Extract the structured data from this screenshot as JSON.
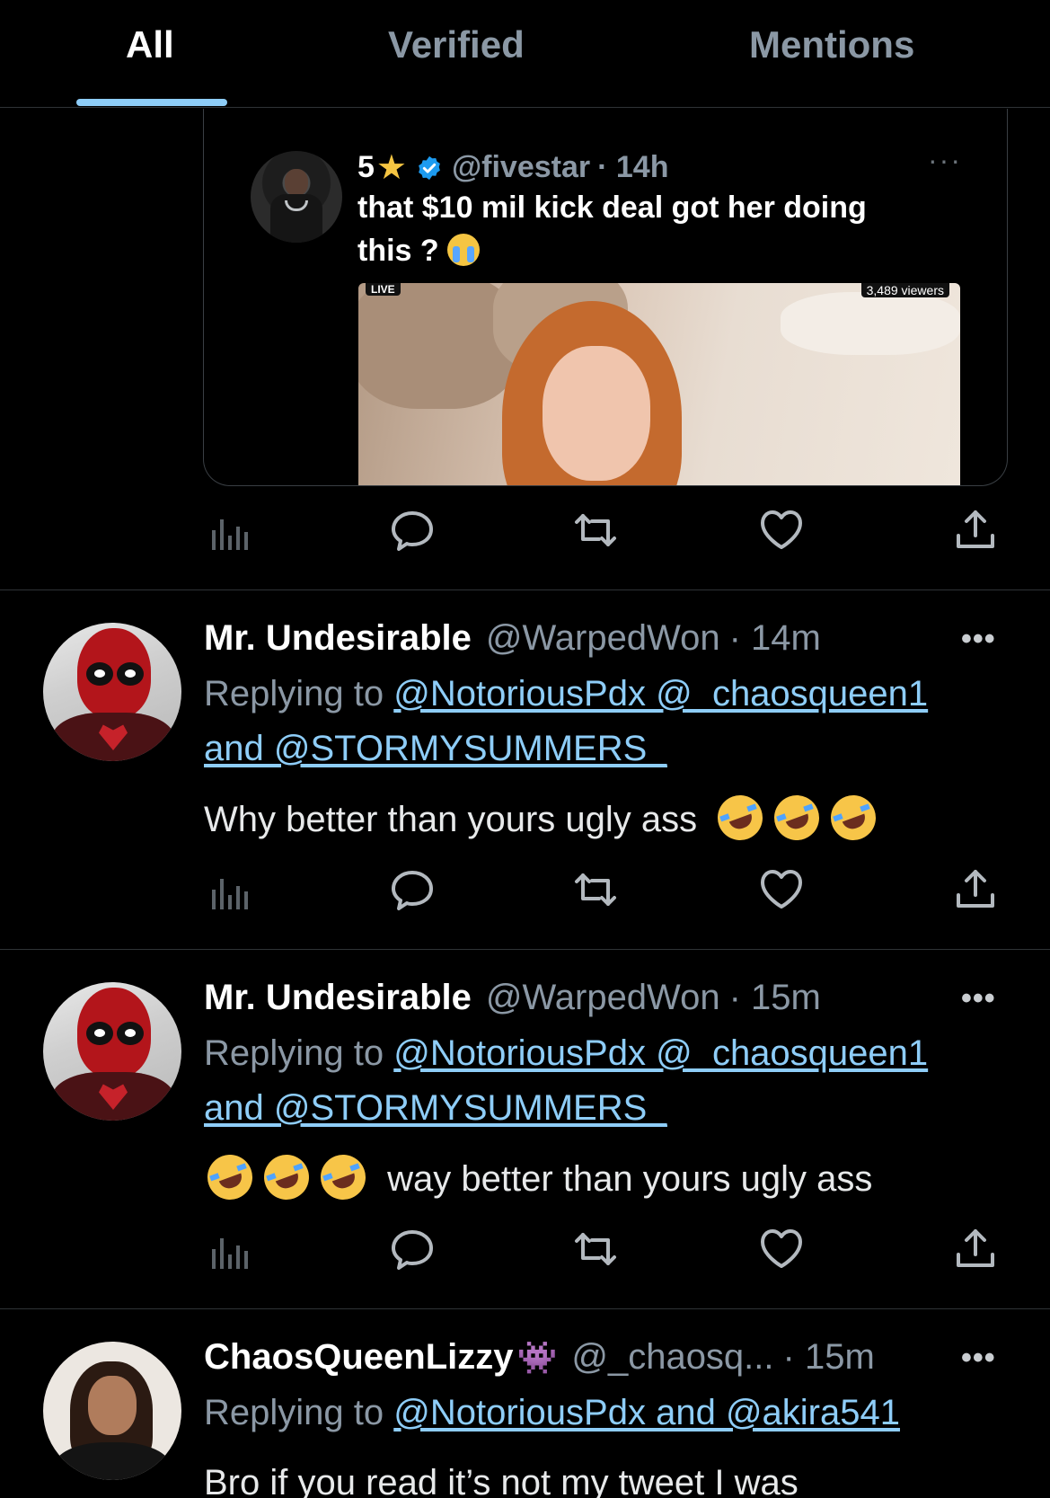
{
  "tabs": [
    {
      "label": "All",
      "active": true
    },
    {
      "label": "Verified",
      "active": false
    },
    {
      "label": "Mentions",
      "active": false
    }
  ],
  "colors": {
    "background": "#000000",
    "accent": "#8ecdf8",
    "muted_text": "#8b98a5",
    "divider": "#2f3336"
  },
  "quoted_tweet": {
    "name": "5",
    "name_emoji": "★",
    "handle": "@fivestar",
    "time": "· 14h",
    "more": "···",
    "text": "that $10 mil kick deal got her doing this ?",
    "media": {
      "live_label": "LIVE",
      "viewers": "3,489 viewers"
    }
  },
  "tweets": [
    {
      "name": "Mr. Undesirable",
      "handle": "@WarpedWon",
      "time": "· 14m",
      "more": "•••",
      "replying_prefix": "Replying to",
      "mention_1": "@NotoriousPdx @_chaosqueen1",
      "mention_2": "and @STORMYSUMMERS_",
      "text": "Why better than yours ugly ass"
    },
    {
      "name": "Mr. Undesirable",
      "handle": "@WarpedWon",
      "time": "· 15m",
      "more": "•••",
      "replying_prefix": "Replying to",
      "mention_1": "@NotoriousPdx @_chaosqueen1",
      "mention_2": "and @STORMYSUMMERS_",
      "text": "way better than yours ugly ass"
    },
    {
      "name": "ChaosQueenLizzy",
      "handle": "@_chaosq...",
      "time": "· 15m",
      "more": "•••",
      "replying_prefix": "Replying to",
      "mention_1": "@NotoriousPdx and @akira541",
      "text": "Bro if you read it’s not my tweet I was"
    }
  ],
  "icons": [
    "views-icon",
    "reply-icon",
    "retweet-icon",
    "like-icon",
    "share-icon",
    "verified-badge-icon",
    "more-icon"
  ]
}
